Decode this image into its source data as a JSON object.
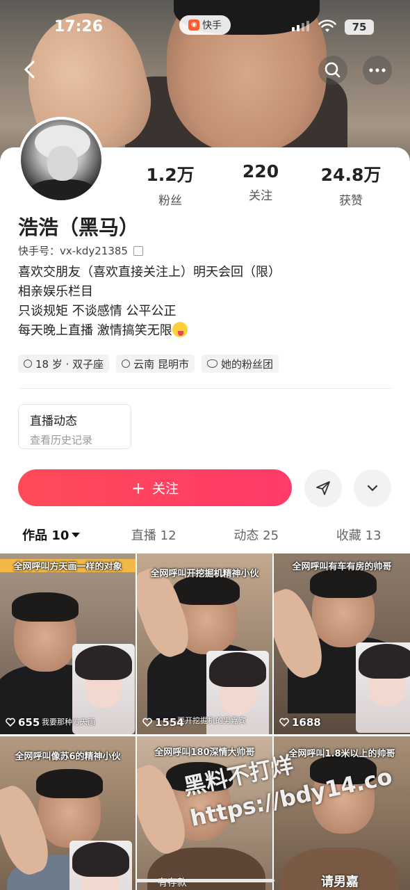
{
  "status_bar": {
    "time": "17:26",
    "app_name": "快手",
    "battery": "75"
  },
  "nav": {
    "back_icon": "chevron-left-icon",
    "search_icon": "search-icon",
    "more_icon": "more-horizontal-icon"
  },
  "profile": {
    "name": "浩浩（黑马）",
    "kuaishou_id": "快手号：vx-kdy21385",
    "stats": [
      {
        "value": "1.2万",
        "label": "粉丝"
      },
      {
        "value": "220",
        "label": "关注"
      },
      {
        "value": "24.8万",
        "label": "获赞"
      }
    ],
    "bio": [
      "喜欢交朋友（喜欢直接关注上）明天会回（限）",
      "相亲娱乐栏目",
      "只谈规矩 不谈感情 公平公正",
      "每天晚上直播  激情搞笑无限"
    ],
    "tags": [
      "18 岁 · 双子座",
      "云南 昆明市",
      "她的粉丝团"
    ]
  },
  "live_card": {
    "title": "直播动态",
    "subtitle": "查看历史记录"
  },
  "actions": {
    "follow_label": "关注",
    "follow_icon": "plus-icon",
    "share_icon": "send-icon",
    "more_icon": "chevron-down-icon"
  },
  "tabs": [
    {
      "label": "作品 10",
      "active": true
    },
    {
      "label": "直播 12",
      "active": false
    },
    {
      "label": "动态 25",
      "active": false
    },
    {
      "label": "收藏 13",
      "active": false
    }
  ],
  "videos": [
    {
      "caption": "全网呼叫方天画一样的对象",
      "likes": "655",
      "sub": "我要那种方天画"
    },
    {
      "caption": "全网呼叫开挖掘机精神小伙",
      "likes": "1554",
      "sub": "要开挖掘机的男嘉宾"
    },
    {
      "caption": "全网呼叫有车有房的帅哥",
      "likes": "1688",
      "sub": ""
    },
    {
      "caption": "全网呼叫像苏6的精神小伙",
      "likes": "",
      "sub": ""
    },
    {
      "caption": "全网呼叫180深情大帅哥",
      "likes": "",
      "sub": "有存款"
    },
    {
      "caption": "全网呼叫1.8米以上的帅哥",
      "likes": "",
      "sub": "请男嘉"
    }
  ],
  "watermark": {
    "line1": "黑料不打烊",
    "line2": "https://bdy14.co"
  }
}
